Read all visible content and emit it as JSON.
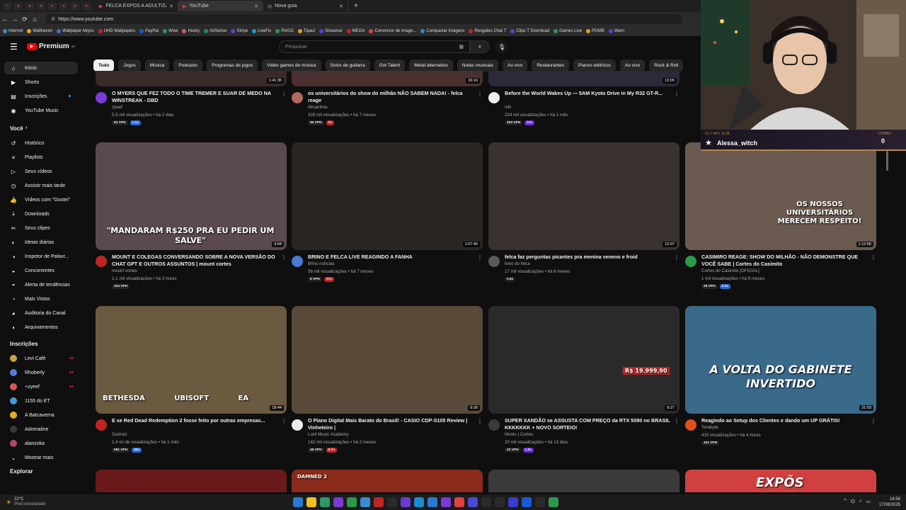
{
  "browser": {
    "tabs": [
      {
        "label": "FELCA EXPÕS A ADULTIZAÇÃO IN",
        "active": false
      },
      {
        "label": "YouTube",
        "active": true
      },
      {
        "label": "Nova guia",
        "active": false
      }
    ],
    "url": "https://www.youtube.com",
    "bookmarks": [
      "Internet",
      "Wallhaven",
      "Wallpaper Abyss",
      "UHD Wallpapers",
      "PayPal",
      "Wise",
      "Husky",
      "AdSense",
      "Stripe",
      "LiveFix",
      "PixGG",
      "Tipaui",
      "Streamar",
      "MEGA",
      "Conversor de image...",
      "Compactar Imagens",
      "Resgates Chat T",
      "Clips T Download",
      "Games Live",
      "PGMB",
      "Warn"
    ]
  },
  "header": {
    "logo": "Premium",
    "logo_country": "BR",
    "search_placeholder": "Pesquisar"
  },
  "sidebar": {
    "main": [
      {
        "label": "Início",
        "icon": "home-icon",
        "active": true
      },
      {
        "label": "Shorts",
        "icon": "shorts-icon"
      },
      {
        "label": "Inscrições",
        "icon": "subscriptions-icon",
        "dot": true
      },
      {
        "label": "YouTube Music",
        "icon": "music-icon"
      }
    ],
    "you_heading": "Você",
    "you": [
      {
        "label": "Histórico",
        "icon": "history-icon"
      },
      {
        "label": "Playlists",
        "icon": "playlist-icon"
      },
      {
        "label": "Seus vídeos",
        "icon": "your-videos-icon"
      },
      {
        "label": "Assistir mais tarde",
        "icon": "watch-later-icon"
      },
      {
        "label": "Vídeos com \"Gostei\"",
        "icon": "like-icon"
      },
      {
        "label": "Downloads",
        "icon": "download-icon"
      },
      {
        "label": "Seus clipes",
        "icon": "clip-icon"
      },
      {
        "label": "Ideias diárias",
        "icon": "idea-icon"
      },
      {
        "label": "Inspetor de Palavr...",
        "icon": "keyword-icon"
      },
      {
        "label": "Concorrentes",
        "icon": "competitors-icon"
      },
      {
        "label": "Alerta de tendências",
        "icon": "trend-icon"
      },
      {
        "label": "Mais Vistos",
        "icon": "most-viewed-icon"
      },
      {
        "label": "Auditoria do Canal",
        "icon": "audit-icon"
      },
      {
        "label": "Arquivamentos",
        "icon": "archive-icon"
      }
    ],
    "subs_heading": "Inscrições",
    "subs": [
      {
        "label": "Levi Café",
        "color": "#c9a04a"
      },
      {
        "label": "Rhoberly",
        "color": "#5a7ad4"
      },
      {
        "label": "+zyeef",
        "color": "#d45a5a"
      },
      {
        "label": "1155 do ET",
        "color": "#4a9ad4"
      },
      {
        "label": "A Batcaverna",
        "color": "#e0b020"
      },
      {
        "label": "Adrenaline",
        "color": "#3a3a3a"
      },
      {
        "label": "alanzoka",
        "color": "#b04a6a"
      }
    ],
    "show_more": "Mostrar mais",
    "explore_heading": "Explorar"
  },
  "chips": [
    "Tudo",
    "Jogos",
    "Música",
    "Podcasts",
    "Programas de jogos",
    "Video games de música",
    "Solos de guitarra",
    "Got Talent",
    "Metal alternativo",
    "Notas musicais",
    "Ao vivo",
    "Restaurantes",
    "Pianos elétricos",
    "Ao vivo",
    "Rock & Roll"
  ],
  "videos_row0": [
    {
      "title": "O MYERS QUE FEZ TODO O TIME TREMER E SUAR DE MEDO NA WINSTREAK - DBD",
      "channel": "zyeef",
      "stats": "5,5 mil visualizações • há 2 dias",
      "vph": "63 VPH",
      "mult": "1.1x",
      "duration": "1:41:35",
      "av": "#7a3ad4"
    },
    {
      "title": "os universitários do show do milhão NÃO SABEM NADA! - felca reage",
      "channel": "felcainhas",
      "stats": "329 mil visualizações • há 7 meses",
      "vph": "50 VPH",
      "mult": "3x",
      "duration": "33:16",
      "av": "#b06a5a"
    },
    {
      "title": "Before the World Wakes Up — 5AM Kyoto Drive in My R32 GT-R...",
      "channel": "nilli",
      "stats": "224 mil visualizações • há 1 mês",
      "vph": "264 VPH",
      "mult": "10x",
      "duration": "13:05",
      "av": "#eeeeee"
    }
  ],
  "videos_row1": [
    {
      "title": "MOUNT E COLEGAS CONVERSANDO SOBRE A NOVA VERSÃO DO CHAT GPT E OUTROS ASSUNTOS | mount cortes",
      "channel": "mount cortes",
      "stats": "1,1 mil visualizações • há 3 horas",
      "vph": "334 VPH",
      "mult": "",
      "duration": "9:04",
      "av": "#c02525",
      "overlay": "\"MANDARAM R$250 PRA EU PEDIR UM SALVE\""
    },
    {
      "title": "BRINO E FELCA LIVE REAGINDO A FANHA",
      "channel": "Brino notícias",
      "stats": "56 mil visualizações • há 7 meses",
      "vph": "8 VPH",
      "mult": "21x",
      "duration": "1:07:49",
      "av": "#4a7ad4",
      "overlay": ""
    },
    {
      "title": "felca faz perguntas picantes pra menina veneno e froid",
      "channel": "lives do felca",
      "stats": "17 mil visualizações • há 6 meses",
      "vph": "0.6x",
      "mult": "",
      "duration": "12:07",
      "av": "#5a5a5a",
      "overlay": ""
    },
    {
      "title": "CASIMIRO REAGE: SHOW DO MILHÃO - NÃO DEMONSTRE QUE VOCÊ SABE | Cortes do Casimito",
      "channel": "Cortes do Casimito [OFICIAL]",
      "stats": "1 mil visualizações • há 9 meses",
      "vph": "28 VPH",
      "mult": "4.3x",
      "duration": "1:12:56",
      "av": "#2a9a4a",
      "overlay": "OS NOSSOS UNIVERSITÁRIOS MERECEM RESPEITO!"
    }
  ],
  "videos_row2": [
    {
      "title": "E se Red Dead Redemption 2 fosse feito por outras empresas...",
      "channel": "Gutmaz",
      "stats": "1,4 mi de visualizações • há 1 mês",
      "vph": "581 VPH",
      "mult": "99x",
      "duration": "18:44",
      "av": "#c02525",
      "overlay": "BETHESDA UBISOFT EA"
    },
    {
      "title": "O Piano Digital Mais Barato do Brasil! - CASIO CDP-S105 Review | Vinheteiro |",
      "channel": "Lord Music Academy",
      "stats": "142 mil visualizações • há 2 meses",
      "vph": "46 VPH",
      "mult": "5.7x",
      "duration": "9:26",
      "av": "#eeeeee",
      "overlay": ""
    },
    {
      "title": "SUPER XANDÃO se ASSUSTA COM PREÇO da RTX 5090 no BRASIL KKKKKKK + NOVO SORTEIO!",
      "channel": "Munlo | Cortes",
      "stats": "20 mil visualizações • há 13 dias",
      "vph": "23 VPH",
      "mult": "1.8x",
      "duration": "8:27",
      "av": "#3a3a3a",
      "overlay": "R$ 19.999,90"
    },
    {
      "title": "Reagindo ao Setup dos Clientes e dando um UP GRÁTIS!",
      "channel": "Terabyte",
      "stats": "415 visualizações • há 4 horas",
      "vph": "101 VPH",
      "mult": "",
      "duration": "21:03",
      "av": "#e0501a",
      "overlay": "A VOLTA DO GABINETE INVERTIDO"
    }
  ],
  "row3_overlays": [
    "DAMNED 2",
    "EXPÕS"
  ],
  "overlay": {
    "label": "ÚLTIMO SUB",
    "name": "Alessa_witch",
    "combo_label": "COMBO",
    "combo_value": "0"
  },
  "taskbar": {
    "weather_temp": "22°C",
    "weather_desc": "Pred ensolarado",
    "time": "16:58",
    "date": "17/08/2025"
  }
}
